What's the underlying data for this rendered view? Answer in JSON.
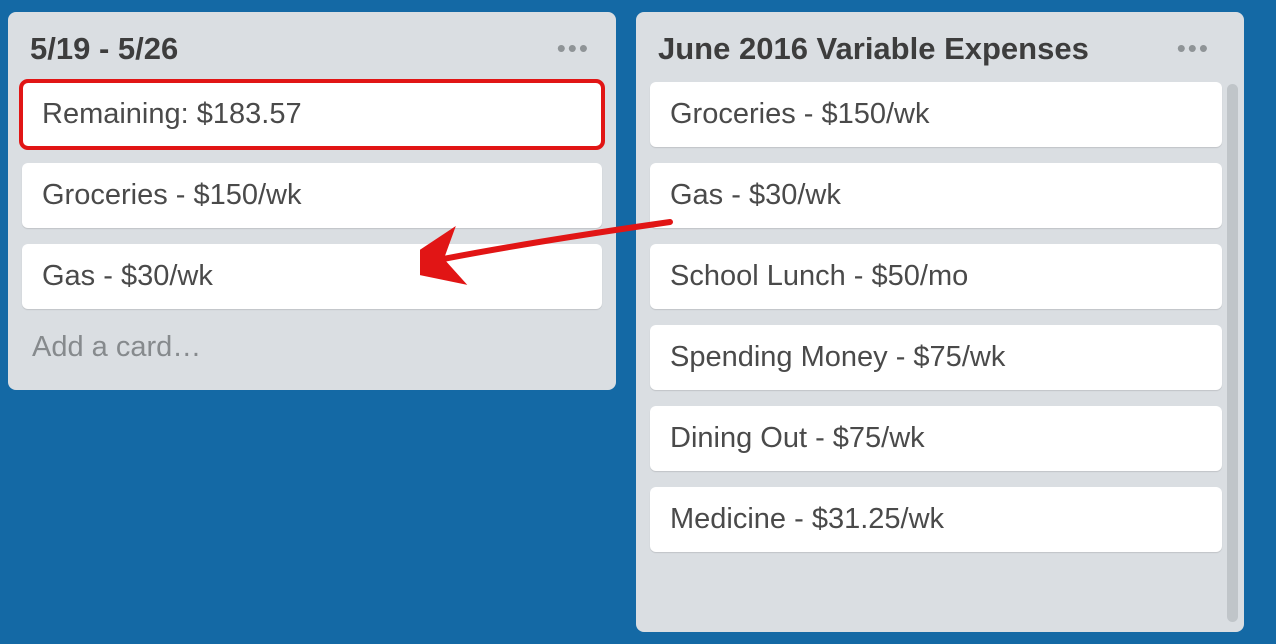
{
  "annotation": {
    "color": "#e11515"
  },
  "lists": [
    {
      "title": "5/19 - 5/26",
      "add_label": "Add a card…",
      "cards": [
        {
          "text": "Remaining: $183.57",
          "highlight": true
        },
        {
          "text": "Groceries - $150/wk"
        },
        {
          "text": "Gas - $30/wk"
        }
      ]
    },
    {
      "title": "June 2016 Variable Expenses",
      "cards": [
        {
          "text": "Groceries - $150/wk"
        },
        {
          "text": "Gas - $30/wk"
        },
        {
          "text": "School Lunch - $50/mo"
        },
        {
          "text": "Spending Money - $75/wk"
        },
        {
          "text": "Dining Out - $75/wk"
        },
        {
          "text": "Medicine - $31.25/wk"
        }
      ]
    }
  ]
}
